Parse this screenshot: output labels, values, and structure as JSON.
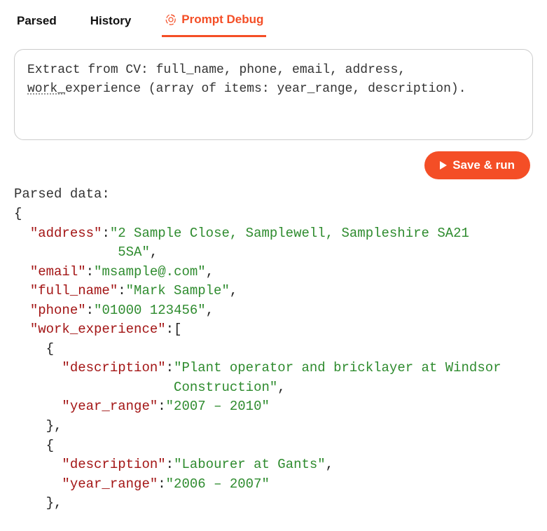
{
  "tabs": {
    "parsed": "Parsed",
    "history": "History",
    "prompt_debug": "Prompt Debug"
  },
  "prompt": {
    "line1": "Extract from CV: full_name, phone, email, address,",
    "line2_a": "work_",
    "line2_b": "experience (array of items: year_range, description)."
  },
  "actions": {
    "save_run": "Save & run"
  },
  "output": {
    "label": "Parsed data:",
    "keys": {
      "address": "\"address\"",
      "email": "\"email\"",
      "full_name": "\"full_name\"",
      "phone": "\"phone\"",
      "work_experience": "\"work_experience\"",
      "description": "\"description\"",
      "year_range": "\"year_range\""
    },
    "vals": {
      "address_l1": "\"2 Sample Close, Samplewell, Sampleshire SA21",
      "address_l2": "5SA\"",
      "email": "\"msample@.com\"",
      "full_name": "\"Mark Sample\"",
      "phone": "\"01000 123456\"",
      "we0_desc_l1": "\"Plant operator and bricklayer at Windsor",
      "we0_desc_l2": "Construction\"",
      "we0_year": "\"2007 – 2010\"",
      "we1_desc": "\"Labourer at Gants\"",
      "we1_year": "\"2006 – 2007\""
    },
    "pun": {
      "open_brace": "{",
      "close_brace_comma": "},",
      "open_bracket": "[",
      "colon": ":",
      "comma": ","
    }
  },
  "parsed_object": {
    "address": "2 Sample Close, Samplewell, Sampleshire SA21 5SA",
    "email": "msample@.com",
    "full_name": "Mark Sample",
    "phone": "01000 123456",
    "work_experience": [
      {
        "description": "Plant operator and bricklayer at Windsor Construction",
        "year_range": "2007 – 2010"
      },
      {
        "description": "Labourer at Gants",
        "year_range": "2006 – 2007"
      }
    ]
  }
}
